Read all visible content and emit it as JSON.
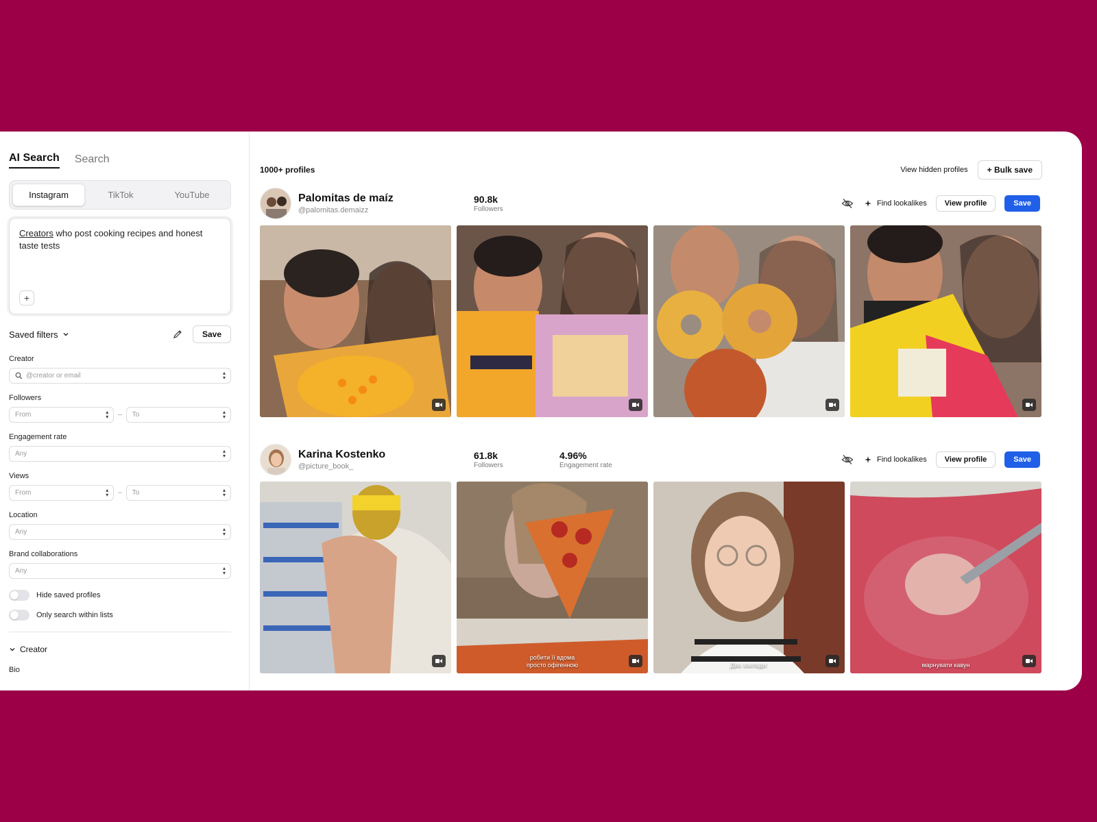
{
  "sidebar": {
    "mode_tabs": [
      "AI Search",
      "Search"
    ],
    "platforms": [
      "Instagram",
      "TikTok",
      "YouTube"
    ],
    "prompt": {
      "underlined": "Creators",
      "rest": " who post cooking recipes and honest taste tests"
    },
    "plus_label": "+",
    "saved_filters_label": "Saved filters",
    "save_label": "Save",
    "filters": {
      "creator": {
        "label": "Creator",
        "placeholder": "@creator or email"
      },
      "followers": {
        "label": "Followers",
        "from": "From",
        "to": "To"
      },
      "engagement": {
        "label": "Engagement rate",
        "value": "Any"
      },
      "views": {
        "label": "Views",
        "from": "From",
        "to": "To"
      },
      "location": {
        "label": "Location",
        "value": "Any"
      },
      "brand": {
        "label": "Brand collaborations",
        "value": "Any"
      }
    },
    "toggles": [
      "Hide saved profiles",
      "Only search within lists"
    ],
    "range_dash": "–",
    "section": "Creator",
    "bio": "Bio"
  },
  "main": {
    "count": "1000+ profiles",
    "view_hidden": "View hidden profiles",
    "bulk_save": "+ Bulk save",
    "find_lookalikes": "Find lookalikes",
    "view_profile": "View profile",
    "save": "Save",
    "profiles": [
      {
        "name": "Palomitas de maíz",
        "handle": "@palomitas.demaizz",
        "stats": [
          {
            "value": "90.8k",
            "label": "Followers"
          }
        ],
        "captions": [
          "",
          "",
          "",
          ""
        ]
      },
      {
        "name": "Karina Kostenko",
        "handle": "@picture_book_",
        "stats": [
          {
            "value": "61.8k",
            "label": "Followers"
          },
          {
            "value": "4.96%",
            "label": "Engagement rate"
          }
        ],
        "captions": [
          "",
          "робити її вдома\nпросто офігенною",
          "Два заклади:",
          "марнувати кавун"
        ]
      }
    ]
  },
  "colors": {
    "background": "#9c0148",
    "primary": "#2060e8"
  },
  "icons": [
    "search-icon",
    "chevron-down-icon",
    "pencil-icon",
    "eye-off-icon",
    "sparkle-icon",
    "video-icon",
    "plus-icon"
  ]
}
